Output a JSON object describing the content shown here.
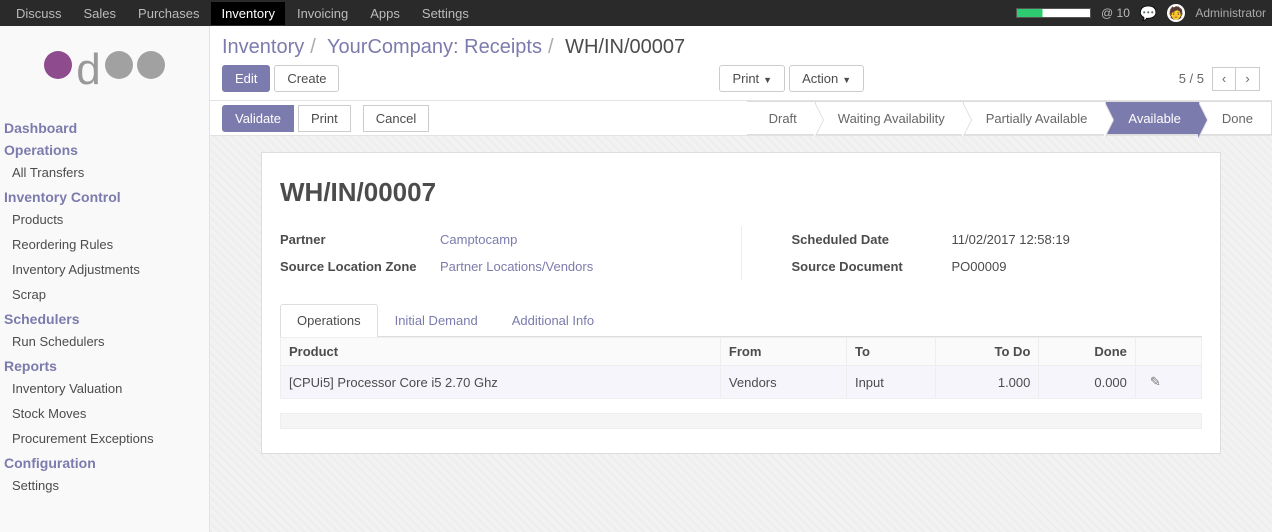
{
  "topnav": {
    "items": [
      "Discuss",
      "Sales",
      "Purchases",
      "Inventory",
      "Invoicing",
      "Apps",
      "Settings"
    ],
    "active_index": 3,
    "at_count": "@ 10",
    "user": "Administrator"
  },
  "sidebar": {
    "sections": [
      {
        "title": "Dashboard",
        "items": []
      },
      {
        "title": "Operations",
        "items": [
          "All Transfers"
        ]
      },
      {
        "title": "Inventory Control",
        "items": [
          "Products",
          "Reordering Rules",
          "Inventory Adjustments",
          "Scrap"
        ]
      },
      {
        "title": "Schedulers",
        "items": [
          "Run Schedulers"
        ]
      },
      {
        "title": "Reports",
        "items": [
          "Inventory Valuation",
          "Stock Moves",
          "Procurement Exceptions"
        ]
      },
      {
        "title": "Configuration",
        "items": [
          "Settings"
        ]
      }
    ]
  },
  "breadcrumbs": {
    "a": "Inventory",
    "b": "YourCompany: Receipts",
    "c": "WH/IN/00007"
  },
  "buttons": {
    "edit": "Edit",
    "create": "Create",
    "print": "Print",
    "action": "Action",
    "validate": "Validate",
    "print2": "Print",
    "cancel": "Cancel"
  },
  "pager": {
    "text": "5 / 5"
  },
  "states": [
    "Draft",
    "Waiting Availability",
    "Partially Available",
    "Available",
    "Done"
  ],
  "states_active_index": 3,
  "record": {
    "title": "WH/IN/00007",
    "fields": {
      "left": [
        {
          "label": "Partner",
          "value": "Camptocamp",
          "link": true
        },
        {
          "label": "Source Location Zone",
          "value": "Partner Locations/Vendors",
          "link": true
        }
      ],
      "right": [
        {
          "label": "Scheduled Date",
          "value": "11/02/2017 12:58:19",
          "link": false
        },
        {
          "label": "Source Document",
          "value": "PO00009",
          "link": false
        }
      ]
    }
  },
  "tabs": {
    "items": [
      "Operations",
      "Initial Demand",
      "Additional Info"
    ],
    "active_index": 0
  },
  "table": {
    "columns": [
      "Product",
      "From",
      "To",
      "To Do",
      "Done",
      ""
    ],
    "rows": [
      {
        "product": "[CPUi5] Processor Core i5 2.70 Ghz",
        "from": "Vendors",
        "to": "Input",
        "todo": "1.000",
        "done": "0.000"
      }
    ]
  }
}
